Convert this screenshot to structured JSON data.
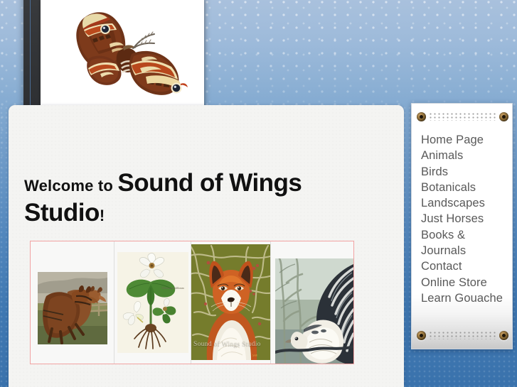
{
  "site": {
    "name": "Sound of Wings Studio",
    "watermark": "Sound of Wings Studio"
  },
  "header": {
    "banner_art": "cecropia-moth-illustration",
    "frame_style": "dark-plate-frame"
  },
  "main": {
    "welcome_prefix": "Welcome to",
    "welcome_title": "Sound of Wings Studio",
    "welcome_suffix": "!"
  },
  "gallery": {
    "border_color": "#f2a3a3",
    "items": [
      {
        "name": "gallery-item-horses",
        "caption": "Two draft horses in harness"
      },
      {
        "name": "gallery-item-trillium",
        "caption": "Trillium botanical plate"
      },
      {
        "name": "gallery-item-fox",
        "caption": "Red fox portrait"
      },
      {
        "name": "gallery-item-grouse",
        "caption": "Ruffed grouse in winter branches"
      }
    ]
  },
  "sidebar": {
    "plaque_style": "screwed-metal-plaque",
    "items": [
      {
        "label": "Home Page",
        "key": "home-page"
      },
      {
        "label": "Animals",
        "key": "animals"
      },
      {
        "label": "Birds",
        "key": "birds"
      },
      {
        "label": "Botanicals",
        "key": "botanicals"
      },
      {
        "label": "Landscapes",
        "key": "landscapes"
      },
      {
        "label": "Just Horses",
        "key": "just-horses"
      },
      {
        "label": "Books & Journals",
        "key": "books-and-journals"
      },
      {
        "label": "Contact",
        "key": "contact"
      },
      {
        "label": "Online Store",
        "key": "online-store"
      },
      {
        "label": "Learn Gouache",
        "key": "learn-gouache"
      }
    ]
  },
  "theme": {
    "background_top": "#a9c1dd",
    "background_bottom": "#3a72ac",
    "panel_bg": "#f4f4f2",
    "nav_text": "#595959",
    "frame_dark": "#333538"
  }
}
